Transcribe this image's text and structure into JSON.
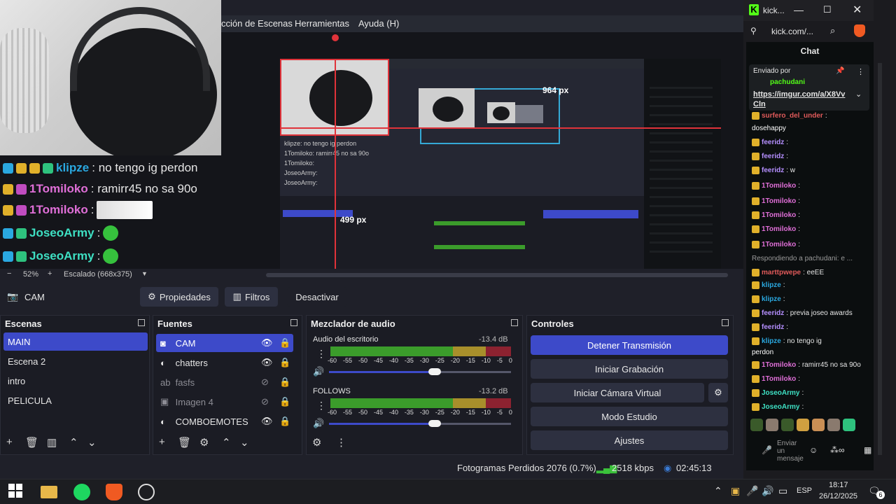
{
  "obs": {
    "menu": [
      "cción de Escenas",
      "Herramientas",
      "Ayuda (H)"
    ],
    "overlay_chat": [
      {
        "user": "klipze",
        "user_color": "#2aa8e0",
        "text": ": no tengo ig perdon"
      },
      {
        "user": "1Tomiloko",
        "user_color": "#e06fd8",
        "text": ": ramirr45 no sa 90o"
      },
      {
        "user": "1Tomiloko",
        "user_color": "#e06fd8",
        "text": ":"
      },
      {
        "user": "JoseoArmy",
        "user_color": "#3ee0c3",
        "text": ":"
      },
      {
        "user": "JoseoArmy",
        "user_color": "#3ee0c3",
        "text": ":"
      }
    ],
    "preview_labels": {
      "width_label": "964 px",
      "height_label": "499 px"
    },
    "zoom": {
      "minus": "−",
      "percent": "52%",
      "plus": "+",
      "scaling": "Escalado (668x375)"
    },
    "source_bar": {
      "selected": "CAM",
      "properties": "Propiedades",
      "filters": "Filtros",
      "deactivate": "Desactivar"
    },
    "scenes": {
      "title": "Escenas",
      "items": [
        "MAIN",
        "Escena 2",
        "intro",
        "PELICULA"
      ]
    },
    "sources": {
      "title": "Fuentes",
      "items": [
        {
          "name": "CAM",
          "icon": "camera-icon",
          "visible": true
        },
        {
          "name": "chatters",
          "icon": "globe-icon",
          "visible": true
        },
        {
          "name": "fasfs",
          "icon": "text-icon",
          "visible": false
        },
        {
          "name": "Imagen 4",
          "icon": "image-icon",
          "visible": false
        },
        {
          "name": "COMBOEMOTES",
          "icon": "globe-icon",
          "visible": true
        }
      ]
    },
    "audio": {
      "title": "Mezclador de audio",
      "channels": [
        {
          "name": "Audio del escritorio",
          "db": "-13.4 dB",
          "level": 0.42
        },
        {
          "name": "FOLLOWS",
          "db": "-13.2 dB",
          "level": 0.42
        }
      ],
      "ticks": [
        "-60",
        "-55",
        "-50",
        "-45",
        "-40",
        "-35",
        "-30",
        "-25",
        "-20",
        "-15",
        "-10",
        "-5",
        "0"
      ]
    },
    "controls": {
      "title": "Controles",
      "buttons": [
        "Detener Transmisión",
        "Iniciar Grabación",
        "Iniciar Cámara Virtual",
        "Modo Estudio",
        "Ajustes"
      ]
    },
    "status": {
      "dropped": "Fotogramas Perdidos 2076 (0.7%)",
      "bitrate": "2518 kbps",
      "time": "02:45:13"
    }
  },
  "browser": {
    "tab_title": "kick...",
    "url": "kick.com/...",
    "chat_title": "Chat",
    "pinned": {
      "by_label": "Enviado por",
      "user": "pachudani",
      "link": "https://imgur.com/a/X8VvCln"
    },
    "messages": [
      {
        "user": "surfero_del_under",
        "color": "#e05a5a",
        "text": ":"
      },
      {
        "user": "",
        "color": "#ffffff",
        "text": "dosehappy"
      },
      {
        "user": "feeridz",
        "color": "#b58fff",
        "text": ":"
      },
      {
        "user": "feeridz",
        "color": "#b58fff",
        "text": ":"
      },
      {
        "user": "feeridz",
        "color": "#b58fff",
        "text": ": w"
      },
      {
        "user": "1Tomiloko",
        "color": "#e06fd8",
        "text": ":"
      },
      {
        "user": "1Tomiloko",
        "color": "#e06fd8",
        "text": ":"
      },
      {
        "user": "1Tomiloko",
        "color": "#e06fd8",
        "text": ":"
      },
      {
        "user": "1Tomiloko",
        "color": "#e06fd8",
        "text": ":"
      },
      {
        "user": "1Tomiloko",
        "color": "#e06fd8",
        "text": ":"
      },
      {
        "user": "",
        "color": "#9a9a9a",
        "text": "Respondiendo a pachudani: e ..."
      },
      {
        "user": "marttpwepe",
        "color": "#e05a5a",
        "text": ": eeEE"
      },
      {
        "user": "klipze",
        "color": "#2aa8e0",
        "text": ":"
      },
      {
        "user": "klipze",
        "color": "#2aa8e0",
        "text": ":"
      },
      {
        "user": "feeridz",
        "color": "#b58fff",
        "text": ": previa joseo awards"
      },
      {
        "user": "feeridz",
        "color": "#b58fff",
        "text": ":"
      },
      {
        "user": "klipze",
        "color": "#2aa8e0",
        "text": ": no tengo ig"
      },
      {
        "user": "",
        "color": "#ffffff",
        "text": "perdon"
      },
      {
        "user": "1Tomiloko",
        "color": "#e06fd8",
        "text": ": ramirr45 no sa 90o"
      },
      {
        "user": "1Tomiloko",
        "color": "#e06fd8",
        "text": ":"
      },
      {
        "user": "JoseoArmy",
        "color": "#3ee0c3",
        "text": ":"
      },
      {
        "user": "JoseoArmy",
        "color": "#3ee0c3",
        "text": ":"
      }
    ],
    "input_placeholder": "Enviar un mensaje"
  },
  "taskbar": {
    "language": "ESP",
    "time": "18:17",
    "date": "26/12/2025",
    "notifications": "6"
  },
  "colors": {
    "accent": "#3d4ac9",
    "kick_green": "#53fc18",
    "meter_green": "#3b9c2b",
    "meter_yellow": "#a88f2b",
    "meter_red": "#8c2230"
  }
}
